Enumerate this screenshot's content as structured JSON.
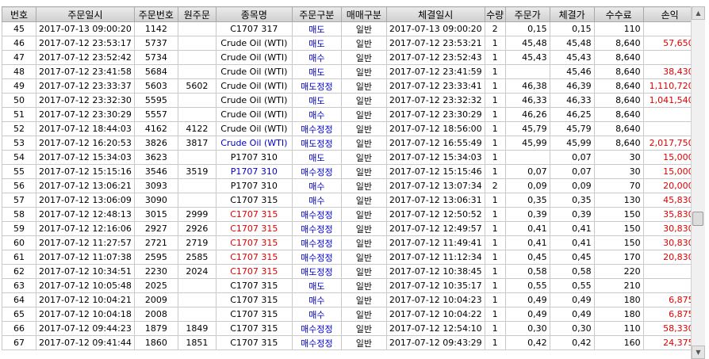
{
  "headers": [
    "번호",
    "주문일시",
    "주문번호",
    "원주문",
    "종목명",
    "주문구분",
    "매매구분",
    "체결일시",
    "수량",
    "주문가",
    "체결가",
    "수수료",
    "손익"
  ],
  "rows": [
    {
      "no": "45",
      "order_time": "2017-07-13 09:00:20",
      "order_no": "1142",
      "orig_no": "",
      "name": "C1707 317",
      "name_color": "black",
      "type": "매도",
      "trade_type": "일반",
      "fill_time": "2017-07-13 09:00:20",
      "qty": "2",
      "order_price": "0,15",
      "fill_price": "0,15",
      "fee": "110",
      "pnl": ""
    },
    {
      "no": "46",
      "order_time": "2017-07-12 23:53:17",
      "order_no": "5737",
      "orig_no": "",
      "name": "Crude Oil (WTI)",
      "name_color": "black",
      "type": "매도",
      "trade_type": "일반",
      "fill_time": "2017-07-12 23:53:21",
      "qty": "1",
      "order_price": "45,48",
      "fill_price": "45,48",
      "fee": "8,640",
      "pnl": "57,650"
    },
    {
      "no": "47",
      "order_time": "2017-07-12 23:52:42",
      "order_no": "5734",
      "orig_no": "",
      "name": "Crude Oil (WTI)",
      "name_color": "black",
      "type": "매수",
      "trade_type": "일반",
      "fill_time": "2017-07-12 23:52:43",
      "qty": "1",
      "order_price": "45,43",
      "fill_price": "45,43",
      "fee": "8,640",
      "pnl": ""
    },
    {
      "no": "48",
      "order_time": "2017-07-12 23:41:58",
      "order_no": "5684",
      "orig_no": "",
      "name": "Crude Oil (WTI)",
      "name_color": "black",
      "type": "매도",
      "trade_type": "일반",
      "fill_time": "2017-07-12 23:41:59",
      "qty": "1",
      "order_price": "",
      "fill_price": "45,46",
      "fee": "8,640",
      "pnl": "38,430"
    },
    {
      "no": "49",
      "order_time": "2017-07-12 23:33:37",
      "order_no": "5603",
      "orig_no": "5602",
      "name": "Crude Oil (WTI)",
      "name_color": "black",
      "type": "매도정정",
      "trade_type": "일반",
      "fill_time": "2017-07-12 23:33:41",
      "qty": "1",
      "order_price": "46,38",
      "fill_price": "46,39",
      "fee": "8,640",
      "pnl": "1,110,720"
    },
    {
      "no": "50",
      "order_time": "2017-07-12 23:32:30",
      "order_no": "5595",
      "orig_no": "",
      "name": "Crude Oil (WTI)",
      "name_color": "black",
      "type": "매도",
      "trade_type": "일반",
      "fill_time": "2017-07-12 23:32:32",
      "qty": "1",
      "order_price": "46,33",
      "fill_price": "46,33",
      "fee": "8,640",
      "pnl": "1,041,540"
    },
    {
      "no": "51",
      "order_time": "2017-07-12 23:30:29",
      "order_no": "5557",
      "orig_no": "",
      "name": "Crude Oil (WTI)",
      "name_color": "black",
      "type": "매수",
      "trade_type": "일반",
      "fill_time": "2017-07-12 23:30:29",
      "qty": "1",
      "order_price": "46,26",
      "fill_price": "46,25",
      "fee": "8,640",
      "pnl": ""
    },
    {
      "no": "52",
      "order_time": "2017-07-12 18:44:03",
      "order_no": "4162",
      "orig_no": "4122",
      "name": "Crude Oil (WTI)",
      "name_color": "black",
      "type": "매수정정",
      "trade_type": "일반",
      "fill_time": "2017-07-12 18:56:00",
      "qty": "1",
      "order_price": "45,79",
      "fill_price": "45,79",
      "fee": "8,640",
      "pnl": ""
    },
    {
      "no": "53",
      "order_time": "2017-07-12 16:20:53",
      "order_no": "3826",
      "orig_no": "3817",
      "name": "Crude Oil (WTI)",
      "name_color": "blue",
      "type": "매도정정",
      "trade_type": "일반",
      "fill_time": "2017-07-12 16:55:49",
      "qty": "1",
      "order_price": "45,99",
      "fill_price": "45,99",
      "fee": "8,640",
      "pnl": "2,017,750"
    },
    {
      "no": "54",
      "order_time": "2017-07-12 15:34:03",
      "order_no": "3623",
      "orig_no": "",
      "name": "P1707 310",
      "name_color": "black",
      "type": "매도",
      "trade_type": "일반",
      "fill_time": "2017-07-12 15:34:03",
      "qty": "1",
      "order_price": "",
      "fill_price": "0,07",
      "fee": "30",
      "pnl": "15,000"
    },
    {
      "no": "55",
      "order_time": "2017-07-12 15:15:16",
      "order_no": "3546",
      "orig_no": "3519",
      "name": "P1707 310",
      "name_color": "blue",
      "type": "매수정정",
      "trade_type": "일반",
      "fill_time": "2017-07-12 15:15:46",
      "qty": "1",
      "order_price": "0,07",
      "fill_price": "0,07",
      "fee": "30",
      "pnl": "15,000"
    },
    {
      "no": "56",
      "order_time": "2017-07-12 13:06:21",
      "order_no": "3093",
      "orig_no": "",
      "name": "P1707 310",
      "name_color": "black",
      "type": "매수",
      "trade_type": "일반",
      "fill_time": "2017-07-12 13:07:34",
      "qty": "2",
      "order_price": "0,09",
      "fill_price": "0,09",
      "fee": "70",
      "pnl": "20,000"
    },
    {
      "no": "57",
      "order_time": "2017-07-12 13:06:09",
      "order_no": "3090",
      "orig_no": "",
      "name": "C1707 315",
      "name_color": "black",
      "type": "매수",
      "trade_type": "일반",
      "fill_time": "2017-07-12 13:06:31",
      "qty": "1",
      "order_price": "0,35",
      "fill_price": "0,35",
      "fee": "130",
      "pnl": "45,830"
    },
    {
      "no": "58",
      "order_time": "2017-07-12 12:48:13",
      "order_no": "3015",
      "orig_no": "2999",
      "name": "C1707 315",
      "name_color": "red",
      "type": "매수정정",
      "trade_type": "일반",
      "fill_time": "2017-07-12 12:50:52",
      "qty": "1",
      "order_price": "0,39",
      "fill_price": "0,39",
      "fee": "150",
      "pnl": "35,830"
    },
    {
      "no": "59",
      "order_time": "2017-07-12 12:16:06",
      "order_no": "2927",
      "orig_no": "2926",
      "name": "C1707 315",
      "name_color": "red",
      "type": "매수정정",
      "trade_type": "일반",
      "fill_time": "2017-07-12 12:49:57",
      "qty": "1",
      "order_price": "0,41",
      "fill_price": "0,41",
      "fee": "150",
      "pnl": "30,830"
    },
    {
      "no": "60",
      "order_time": "2017-07-12 11:27:57",
      "order_no": "2721",
      "orig_no": "2719",
      "name": "C1707 315",
      "name_color": "red",
      "type": "매수정정",
      "trade_type": "일반",
      "fill_time": "2017-07-12 11:49:41",
      "qty": "1",
      "order_price": "0,41",
      "fill_price": "0,41",
      "fee": "150",
      "pnl": "30,830"
    },
    {
      "no": "61",
      "order_time": "2017-07-12 11:07:38",
      "order_no": "2595",
      "orig_no": "2585",
      "name": "C1707 315",
      "name_color": "red",
      "type": "매수정정",
      "trade_type": "일반",
      "fill_time": "2017-07-12 11:12:34",
      "qty": "1",
      "order_price": "0,45",
      "fill_price": "0,45",
      "fee": "170",
      "pnl": "20,830"
    },
    {
      "no": "62",
      "order_time": "2017-07-12 10:34:51",
      "order_no": "2230",
      "orig_no": "2024",
      "name": "C1707 315",
      "name_color": "red",
      "type": "매도정정",
      "trade_type": "일반",
      "fill_time": "2017-07-12 10:38:45",
      "qty": "1",
      "order_price": "0,58",
      "fill_price": "0,58",
      "fee": "220",
      "pnl": ""
    },
    {
      "no": "63",
      "order_time": "2017-07-12 10:05:48",
      "order_no": "2025",
      "orig_no": "",
      "name": "C1707 315",
      "name_color": "black",
      "type": "매도",
      "trade_type": "일반",
      "fill_time": "2017-07-12 10:35:17",
      "qty": "1",
      "order_price": "0,55",
      "fill_price": "0,55",
      "fee": "210",
      "pnl": ""
    },
    {
      "no": "64",
      "order_time": "2017-07-12 10:04:21",
      "order_no": "2009",
      "orig_no": "",
      "name": "C1707 315",
      "name_color": "black",
      "type": "매수",
      "trade_type": "일반",
      "fill_time": "2017-07-12 10:04:23",
      "qty": "1",
      "order_price": "0,49",
      "fill_price": "0,49",
      "fee": "180",
      "pnl": "6,875"
    },
    {
      "no": "65",
      "order_time": "2017-07-12 10:04:18",
      "order_no": "2008",
      "orig_no": "",
      "name": "C1707 315",
      "name_color": "black",
      "type": "매수",
      "trade_type": "일반",
      "fill_time": "2017-07-12 10:04:22",
      "qty": "1",
      "order_price": "0,49",
      "fill_price": "0,49",
      "fee": "180",
      "pnl": "6,875"
    },
    {
      "no": "66",
      "order_time": "2017-07-12 09:44:23",
      "order_no": "1879",
      "orig_no": "1849",
      "name": "C1707 315",
      "name_color": "black",
      "type": "매수정정",
      "trade_type": "일반",
      "fill_time": "2017-07-12 12:54:10",
      "qty": "1",
      "order_price": "0,30",
      "fill_price": "0,30",
      "fee": "110",
      "pnl": "58,330"
    },
    {
      "no": "67",
      "order_time": "2017-07-12 09:41:44",
      "order_no": "1860",
      "orig_no": "1851",
      "name": "C1707 315",
      "name_color": "black",
      "type": "매수정정",
      "trade_type": "일반",
      "fill_time": "2017-07-12 09:43:29",
      "qty": "1",
      "order_price": "0,42",
      "fill_price": "0,42",
      "fee": "160",
      "pnl": "24,375"
    }
  ],
  "colors": {
    "name_black": "#000000",
    "name_blue": "#0000cc",
    "name_red": "#e00000",
    "type_text": "#0000cc",
    "pnl_text": "#e00000",
    "header_bg": "#d9d9d9"
  },
  "scrollbar": {
    "up_icon": "scroll-up-arrow",
    "down_icon": "scroll-down-arrow"
  }
}
